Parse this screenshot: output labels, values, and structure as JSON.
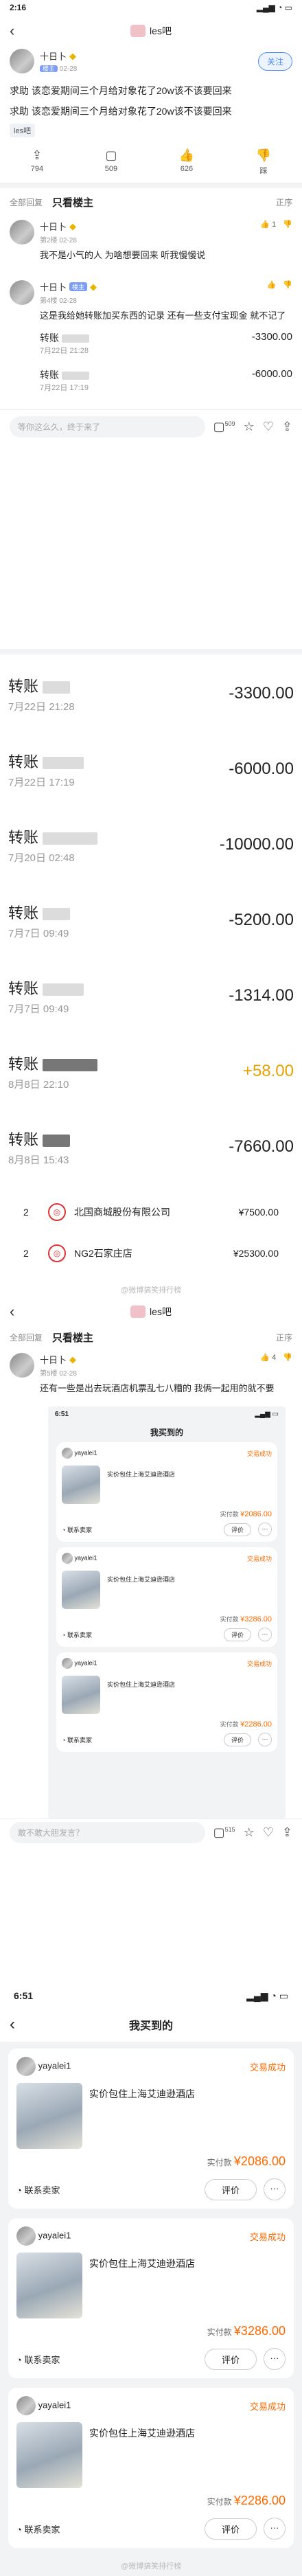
{
  "status1": {
    "time": "2:16"
  },
  "header": {
    "forum": "les吧"
  },
  "op": {
    "name": "十日卜",
    "date": "02-28",
    "follow": "关注"
  },
  "post": {
    "line1": "求助 该恋爱期间三个月给对象花了20w该不该要回来",
    "line2": "求助 该恋爱期间三个月给对象花了20w该不该要回来",
    "tag": "les吧"
  },
  "actions": [
    {
      "icon": "share-icon",
      "label": "794"
    },
    {
      "icon": "comment-icon",
      "label": "509"
    },
    {
      "icon": "like-icon",
      "label": "626"
    },
    {
      "icon": "dislike-icon",
      "label": "踩"
    }
  ],
  "filter": {
    "all": "全部回复",
    "only": "只看楼主",
    "sort": "正序"
  },
  "replies": [
    {
      "name": "十日卜",
      "floor": "第2楼",
      "date": "02-28",
      "text": "我不是小气的人 为啥想要回来 听我慢慢说",
      "likes": "1"
    },
    {
      "name": "十日卜",
      "level": "楼主",
      "floor": "第4楼",
      "date": "02-28",
      "text": "这是我给她转账加买东西的记录 还有一些支付宝现金 就不记了"
    }
  ],
  "mini_tx": [
    {
      "name": "转账",
      "date": "7月22日 21:28",
      "amount": "-3300.00"
    },
    {
      "name": "转账",
      "date": "7月22日 17:19",
      "amount": "-6000.00"
    }
  ],
  "inputbar": {
    "placeholder": "等你这么久，终于来了",
    "count": "509"
  },
  "transactions": [
    {
      "name": "转账",
      "date": "7月22日 21:28",
      "amount": "-3300.00"
    },
    {
      "name": "转账",
      "date": "7月22日 17:19",
      "amount": "-6000.00"
    },
    {
      "name": "转账",
      "date": "7月20日 02:48",
      "amount": "-10000.00"
    },
    {
      "name": "转账",
      "date": "7月7日 09:49",
      "amount": "-5200.00"
    },
    {
      "name": "转账",
      "date": "7月7日 09:49",
      "amount": "-1314.00"
    },
    {
      "name": "转账",
      "date": "8月8日 22:10",
      "amount": "+58.00"
    },
    {
      "name": "转账",
      "date": "8月8日 15:43",
      "amount": "-7660.00"
    }
  ],
  "shops": [
    {
      "n": "2",
      "name": "北国商城股份有限公司",
      "amount": "¥7500.00"
    },
    {
      "n": "2",
      "name": "NG2石家庄店",
      "amount": "¥25300.00"
    }
  ],
  "watermark": "@微博搞笑排行榜",
  "reply3": {
    "name": "十日卜",
    "floor": "第5楼",
    "date": "02-28",
    "text": "还有一些是出去玩酒店机票乱七八糟的 我俩一起用的就不要",
    "likes": "4"
  },
  "embedded": {
    "time": "6:51",
    "title": "我买到的",
    "inputbar": "敢不敢大胆发言？",
    "count": "515"
  },
  "bought": {
    "time": "6:51",
    "title": "我买到的",
    "seller": "yayalei1",
    "status": "交易成功",
    "contact": "联系卖家",
    "eval": "评价",
    "more": "···",
    "paid": "实付款",
    "orders": [
      {
        "title": "实价包住上海艾迪逊酒店",
        "price": "¥2086.00"
      },
      {
        "title": "实价包住上海艾迪逊酒店",
        "price": "¥3286.00"
      },
      {
        "title": "实价包住上海艾迪逊酒店",
        "price": "¥2286.00"
      }
    ]
  }
}
